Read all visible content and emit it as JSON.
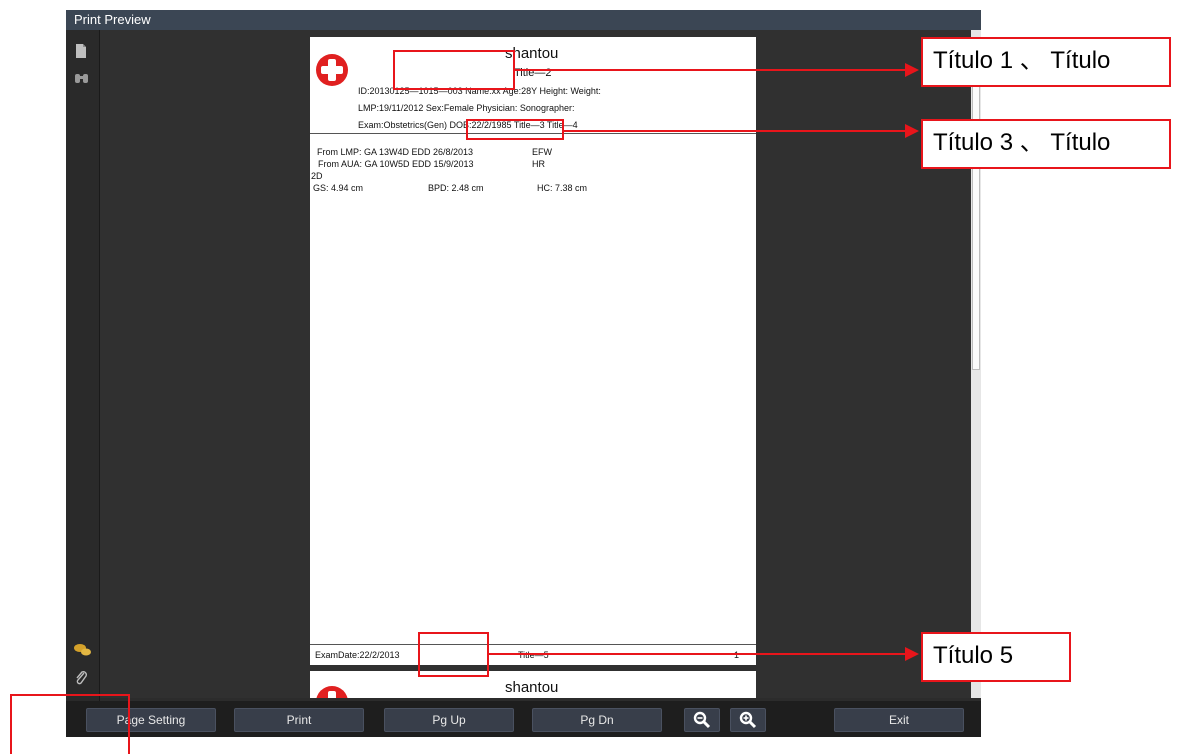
{
  "window": {
    "title": "Print Preview"
  },
  "sidebar": {
    "icons": [
      "document-icon",
      "binoculars-icon",
      "comments-icon",
      "paperclip-icon"
    ]
  },
  "page": {
    "hospital": "shantou",
    "title2": "Title—2",
    "line_id": "ID:20130125—1015—003  Name:xx  Age:28Y  Height:  Weight:",
    "line_lmp": "LMP:19/11/2012  Sex:Female  Physician:  Sonographer:",
    "line_exam": "Exam:Obstetrics(Gen)  DOB:22/2/1985  Title—3  Title—4",
    "from_lmp": "From LMP: GA  13W4D  EDD 26/8/2013",
    "efw": "EFW",
    "from_aua": "From AUA: GA 10W5D EDD 15/9/2013",
    "hr": "HR",
    "mode": "2D",
    "gs": "GS: 4.94 cm",
    "bpd": "BPD: 2.48 cm",
    "hc": "HC: 7.38 cm",
    "footer_date": "ExamDate:22/2/2013",
    "footer_title5": "Title—5",
    "footer_page": "1"
  },
  "page2": {
    "hospital": "shantou"
  },
  "toolbar": {
    "page_setting": "Page Setting",
    "print": "Print",
    "pg_up": "Pg Up",
    "pg_dn": "Pg Dn",
    "zoom_out_icon": "zoom-out-icon",
    "zoom_in_icon": "zoom-in-icon",
    "exit": "Exit"
  },
  "annotations": {
    "callout1": "Título 1 、 Título",
    "callout3": "Título 3 、 Título",
    "callout5": "Título 5"
  },
  "colors": {
    "annotation_red": "#e8151b",
    "titlebar": "#3b4654",
    "button": "#383e4a"
  }
}
